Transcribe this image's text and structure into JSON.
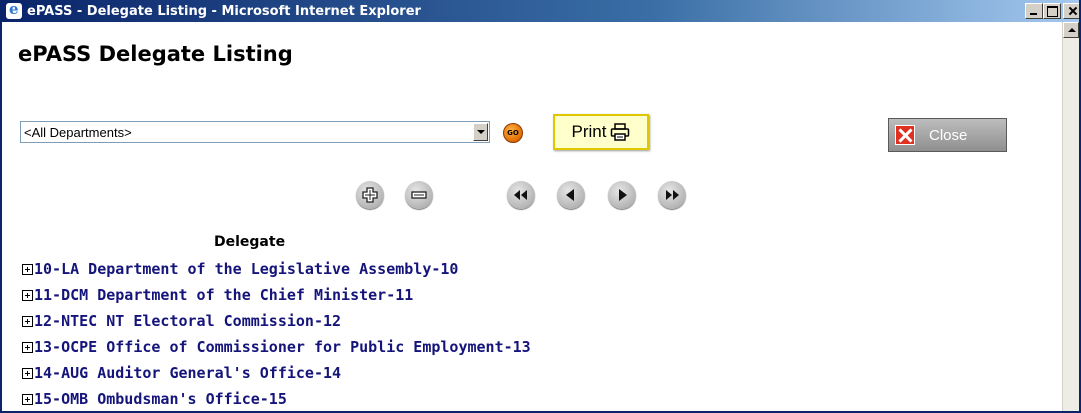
{
  "window": {
    "title": "ePASS - Delegate Listing - Microsoft Internet Explorer"
  },
  "page": {
    "title": "ePASS Delegate Listing"
  },
  "filter": {
    "department_selected": "<All Departments>",
    "go_label": "GO"
  },
  "toolbar": {
    "print_label": "Print",
    "close_label": "Close"
  },
  "nav_icons": [
    "expand-all-icon",
    "collapse-all-icon",
    "first-page-icon",
    "previous-page-icon",
    "next-page-icon",
    "last-page-icon"
  ],
  "listing": {
    "column_header": "Delegate",
    "rows": [
      "10-LA Department of the Legislative Assembly-10",
      "11-DCM Department of the Chief Minister-11",
      "12-NTEC NT Electoral Commission-12",
      "13-OCPE Office of Commissioner for Public Employment-13",
      "14-AUG Auditor General's Office-14",
      "15-OMB Ombudsman's Office-15"
    ]
  },
  "colors": {
    "titlebar": "#0a246a",
    "link_text": "#14147a",
    "print_bg": "#ffffcc",
    "close_x": "#e03020",
    "go_button": "#e06c00"
  }
}
